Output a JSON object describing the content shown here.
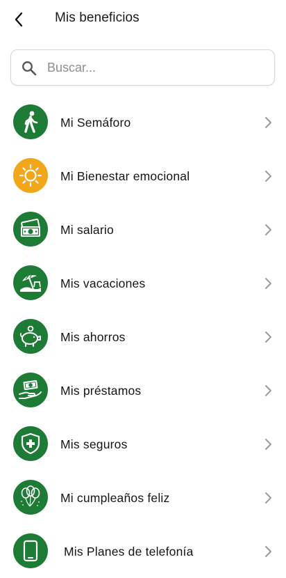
{
  "header": {
    "back_icon": "arrow-left-icon",
    "title": "Mis beneficios"
  },
  "search": {
    "placeholder": "Buscar...",
    "value": "",
    "icon": "search-icon"
  },
  "colors": {
    "green": "#1E7B36",
    "orange": "#F2A71B",
    "chevron": "#9a9a9a"
  },
  "items": [
    {
      "label": "Mi Semáforo",
      "icon": "walking-person-icon",
      "color": "green"
    },
    {
      "label": "Mi Bienestar emocional",
      "icon": "sun-icon",
      "color": "orange"
    },
    {
      "label": "Mi salario",
      "icon": "money-bills-icon",
      "color": "green"
    },
    {
      "label": "Mis vacaciones",
      "icon": "beach-umbrella-icon",
      "color": "green"
    },
    {
      "label": "Mis ahorros",
      "icon": "piggy-bank-icon",
      "color": "green"
    },
    {
      "label": "Mis préstamos",
      "icon": "hand-money-icon",
      "color": "green"
    },
    {
      "label": "Mis seguros",
      "icon": "shield-plus-icon",
      "color": "green"
    },
    {
      "label": "Mi cumpleaños feliz",
      "icon": "balloons-icon",
      "color": "green"
    },
    {
      "label": "Mis Planes de telefonía",
      "icon": "phone-icon",
      "color": "green"
    }
  ]
}
